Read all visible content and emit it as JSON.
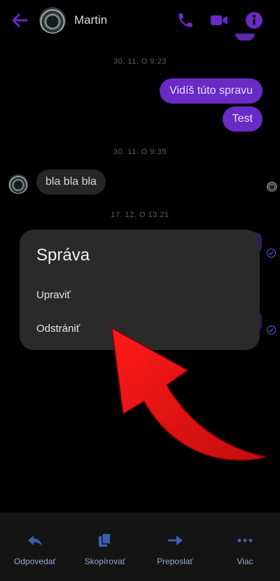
{
  "header": {
    "contact_name": "Martin",
    "icons": [
      "back-arrow-icon",
      "phone-icon",
      "video-icon",
      "info-icon"
    ],
    "accent_color": "#7b2fe0"
  },
  "conversation": {
    "timestamps": [
      "30. 11. O 9:23",
      "30. 11. O 9:35",
      "17. 12. O 13:21"
    ],
    "outgoing": [
      "Vidíš túto spravu",
      "Test"
    ],
    "incoming": [
      "bla bla bla"
    ]
  },
  "dialog": {
    "title": "Správa",
    "items": [
      "Upraviť",
      "Odstrániť"
    ]
  },
  "bottom_bar": {
    "actions": [
      {
        "label": "Odpovedať",
        "icon": "reply-icon"
      },
      {
        "label": "Skopírovať",
        "icon": "copy-icon"
      },
      {
        "label": "Preposlať",
        "icon": "forward-icon"
      },
      {
        "label": "Viac",
        "icon": "more-icon"
      }
    ],
    "icon_color": "#3a5fb0"
  }
}
